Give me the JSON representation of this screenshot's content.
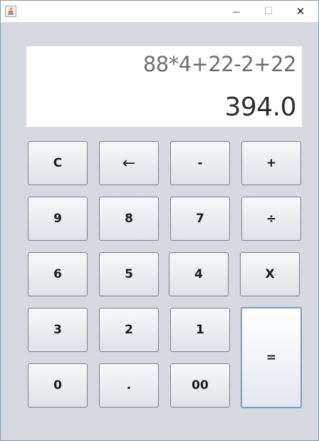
{
  "titlebar": {
    "minimize_glyph": "—",
    "maximize_glyph": "☐",
    "close_glyph": "✕"
  },
  "display": {
    "expression": "88*4+22-2+22",
    "result": "394.0"
  },
  "keys": {
    "clear": "C",
    "backspace": "←",
    "minus": "-",
    "plus": "+",
    "nine": "9",
    "eight": "8",
    "seven": "7",
    "divide": "÷",
    "six": "6",
    "five": "5",
    "four": "4",
    "multiply": "X",
    "three": "3",
    "two": "2",
    "one": "1",
    "equals": "=",
    "zero": "0",
    "decimal": ".",
    "double_zero": "00"
  }
}
